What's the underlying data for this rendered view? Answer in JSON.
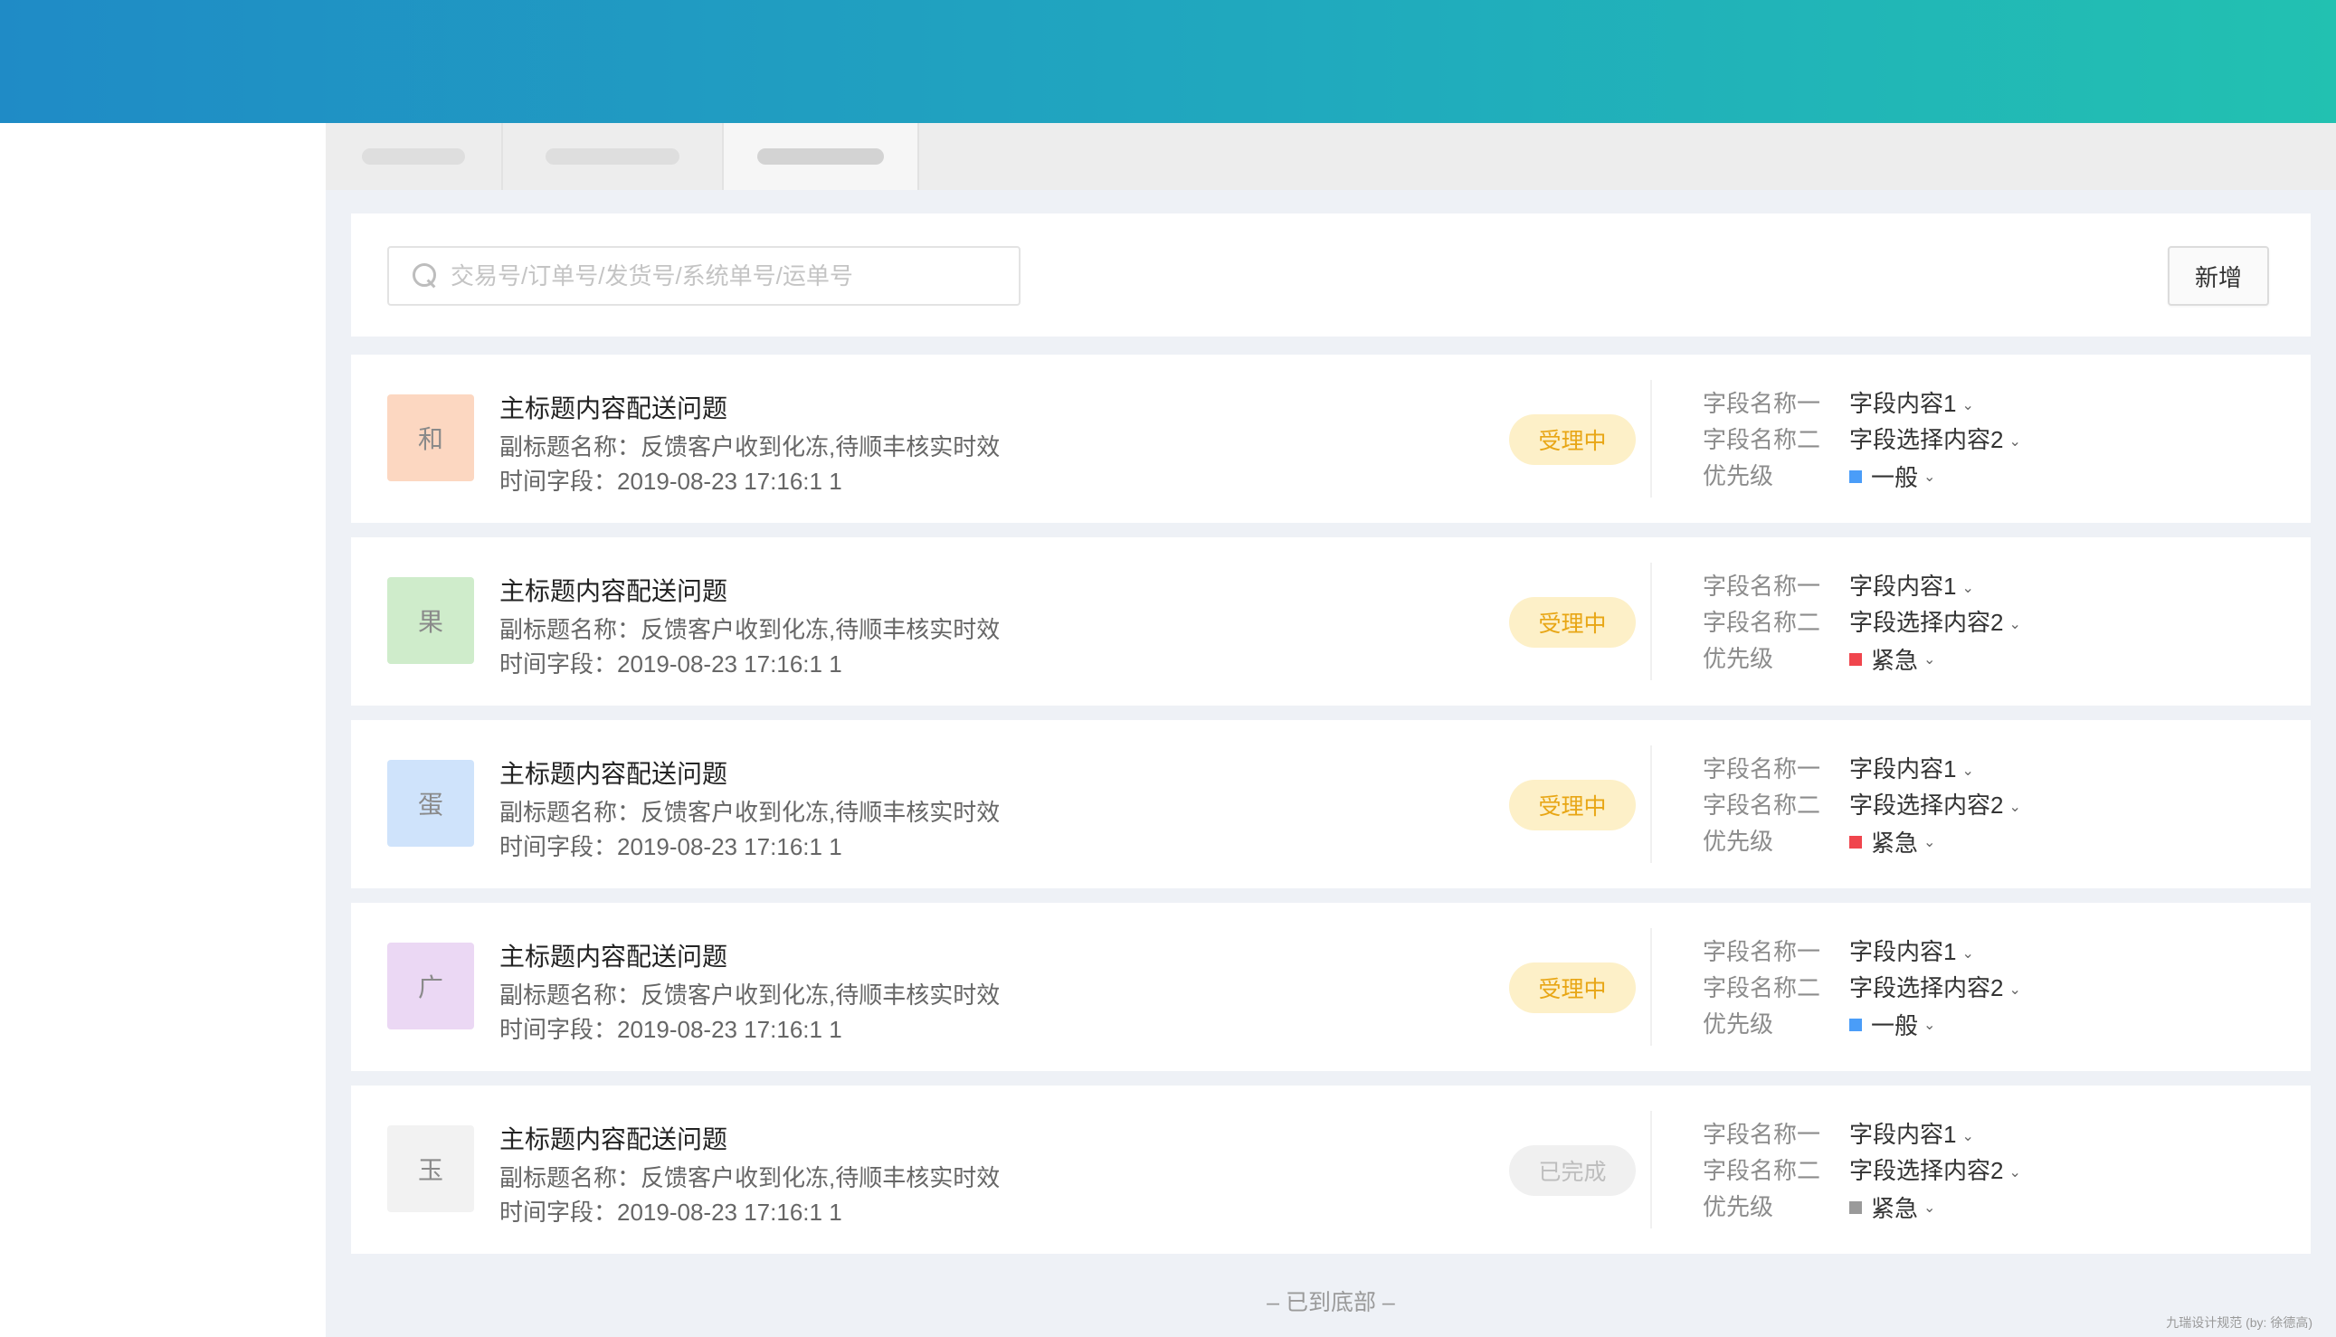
{
  "header": {
    "color_start": "#1f8bc6",
    "color_end": "#22c1b1"
  },
  "tabs": [
    {
      "label": "",
      "active": false
    },
    {
      "label": "",
      "active": false
    },
    {
      "label": "",
      "active": true
    }
  ],
  "search": {
    "placeholder": "交易号/订单号/发货号/系统单号/运单号",
    "value": "",
    "icon": "search-icon"
  },
  "toolbar": {
    "add_label": "新增"
  },
  "field_labels": {
    "field1": "字段名称一",
    "field2": "字段名称二",
    "priority": "优先级"
  },
  "items": [
    {
      "avatar": "和",
      "avatar_bg": "#fcd7c1",
      "title": "主标题内容配送问题",
      "subtitle": "副标题名称：反馈客户收到化冻,待顺丰核实时效",
      "time": "时间字段：2019-08-23 17:16:1 1",
      "status": "受理中",
      "field1": "字段内容1",
      "field2": "字段选择内容2",
      "priority": "一般",
      "priority_color": "#4a9df8"
    },
    {
      "avatar": "果",
      "avatar_bg": "#cfeccb",
      "title": "主标题内容配送问题",
      "subtitle": "副标题名称：反馈客户收到化冻,待顺丰核实时效",
      "time": "时间字段：2019-08-23 17:16:1 1",
      "status": "受理中",
      "field1": "字段内容1",
      "field2": "字段选择内容2",
      "priority": "紧急",
      "priority_color": "#f0454d"
    },
    {
      "avatar": "蛋",
      "avatar_bg": "#cfe3fb",
      "title": "主标题内容配送问题",
      "subtitle": "副标题名称：反馈客户收到化冻,待顺丰核实时效",
      "time": "时间字段：2019-08-23 17:16:1 1",
      "status": "受理中",
      "field1": "字段内容1",
      "field2": "字段选择内容2",
      "priority": "紧急",
      "priority_color": "#f0454d"
    },
    {
      "avatar": "广",
      "avatar_bg": "#ebd8f4",
      "title": "主标题内容配送问题",
      "subtitle": "副标题名称：反馈客户收到化冻,待顺丰核实时效",
      "time": "时间字段：2019-08-23 17:16:1 1",
      "status": "受理中",
      "field1": "字段内容1",
      "field2": "字段选择内容2",
      "priority": "一般",
      "priority_color": "#4a9df8"
    },
    {
      "avatar": "玉",
      "avatar_bg": "#f2f2f2",
      "title": "主标题内容配送问题",
      "subtitle": "副标题名称：反馈客户收到化冻,待顺丰核实时效",
      "time": "时间字段：2019-08-23 17:16:1 1",
      "status": "已完成",
      "field1": "字段内容1",
      "field2": "字段选择内容2",
      "priority": "紧急",
      "priority_color": "#9a9a9a"
    }
  ],
  "footer": {
    "end_text": "– 已到底部 –"
  },
  "credit": "九瑞设计规范 (by: 徐德高)"
}
